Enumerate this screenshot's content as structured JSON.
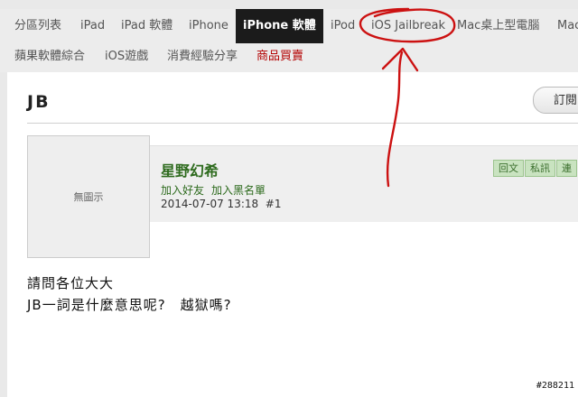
{
  "nav_top": [
    "分區列表",
    "iPad",
    "iPad 軟體",
    "iPhone",
    "iPhone 軟體",
    "iPod",
    "iOS Jailbreak",
    "Mac桌上型電腦",
    "Mac"
  ],
  "nav_second": [
    "蘋果軟體綜合",
    "iOS遊戲",
    "消費經驗分享",
    "商品買賣"
  ],
  "page_title": "JB",
  "subscribe_label": "訂閱",
  "avatar_placeholder": "無圖示",
  "post": {
    "author": "星野幻希",
    "add_friend": "加入好友",
    "add_blacklist": "加入黑名單",
    "datetime": "2014-07-07 13:18",
    "floor": "#1",
    "actions": [
      "回文",
      "私訊",
      "連"
    ],
    "content": [
      "請問各位大大",
      "JB一詞是什麼意思呢?　越獄嗎?"
    ]
  },
  "watermark": "#288211",
  "colors": {
    "active_tab_bg": "#1b1b1b",
    "author": "#2e6b1e",
    "annotation": "#cc1111",
    "market": "#b30000"
  }
}
